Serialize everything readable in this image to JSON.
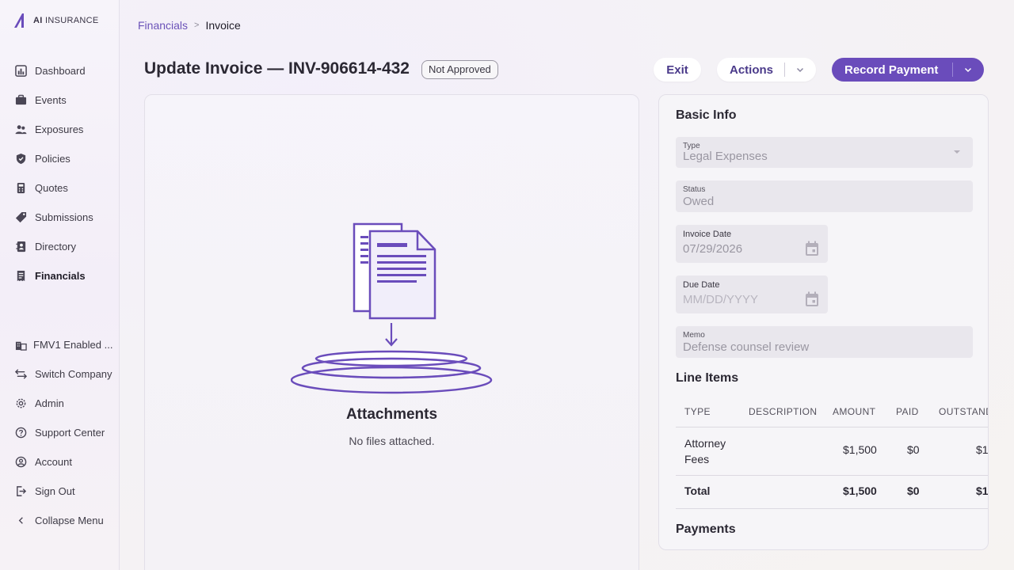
{
  "brand": {
    "logo_bold": "AI",
    "logo_text": " INSURANCE"
  },
  "sidebar": {
    "items": [
      {
        "label": "Dashboard",
        "icon": "dashboard-icon"
      },
      {
        "label": "Events",
        "icon": "briefcase-icon"
      },
      {
        "label": "Exposures",
        "icon": "people-icon"
      },
      {
        "label": "Policies",
        "icon": "shield-icon"
      },
      {
        "label": "Quotes",
        "icon": "calculator-icon"
      },
      {
        "label": "Submissions",
        "icon": "tag-icon"
      },
      {
        "label": "Directory",
        "icon": "contacts-icon"
      },
      {
        "label": "Financials",
        "icon": "receipt-icon",
        "active": true
      }
    ],
    "bottom_items": [
      {
        "label": "FMV1 Enabled ...",
        "icon": "building-icon"
      },
      {
        "label": "Switch Company",
        "icon": "switch-icon"
      },
      {
        "label": "Admin",
        "icon": "gear-icon"
      },
      {
        "label": "Support Center",
        "icon": "help-icon"
      },
      {
        "label": "Account",
        "icon": "account-icon"
      },
      {
        "label": "Sign Out",
        "icon": "logout-icon"
      },
      {
        "label": "Collapse Menu",
        "icon": "chevron-left-icon"
      }
    ]
  },
  "breadcrumb": {
    "parent": "Financials",
    "separator": ">",
    "current": "Invoice"
  },
  "header": {
    "title": "Update Invoice — INV-906614-432",
    "status": "Not Approved",
    "exit_label": "Exit",
    "actions_label": "Actions",
    "primary_label": "Record Payment"
  },
  "attachments": {
    "title": "Attachments",
    "empty_text": "No files attached."
  },
  "basic_info": {
    "title": "Basic Info",
    "type": {
      "label": "Type",
      "value": "Legal Expenses"
    },
    "status": {
      "label": "Status",
      "value": "Owed"
    },
    "invoice_date": {
      "label": "Invoice Date",
      "value": "07/29/2026"
    },
    "due_date": {
      "label": "Due Date",
      "placeholder": "MM/DD/YYYY"
    },
    "memo": {
      "label": "Memo",
      "value": "Defense counsel review"
    }
  },
  "line_items": {
    "title": "Line Items",
    "columns": [
      "TYPE",
      "DESCRIPTION",
      "AMOUNT",
      "PAID",
      "OUTSTANDI"
    ],
    "rows": [
      {
        "type_line1": "Attorney",
        "type_line2": "Fees",
        "description": "",
        "amount": "$1,500",
        "paid": "$0",
        "outstanding": "$1,5"
      }
    ],
    "total": {
      "label": "Total",
      "amount": "$1,500",
      "paid": "$0",
      "outstanding": "$1,5"
    }
  },
  "payments": {
    "title": "Payments"
  },
  "colors": {
    "accent": "#6a4cbb",
    "link": "#6b52b8"
  }
}
